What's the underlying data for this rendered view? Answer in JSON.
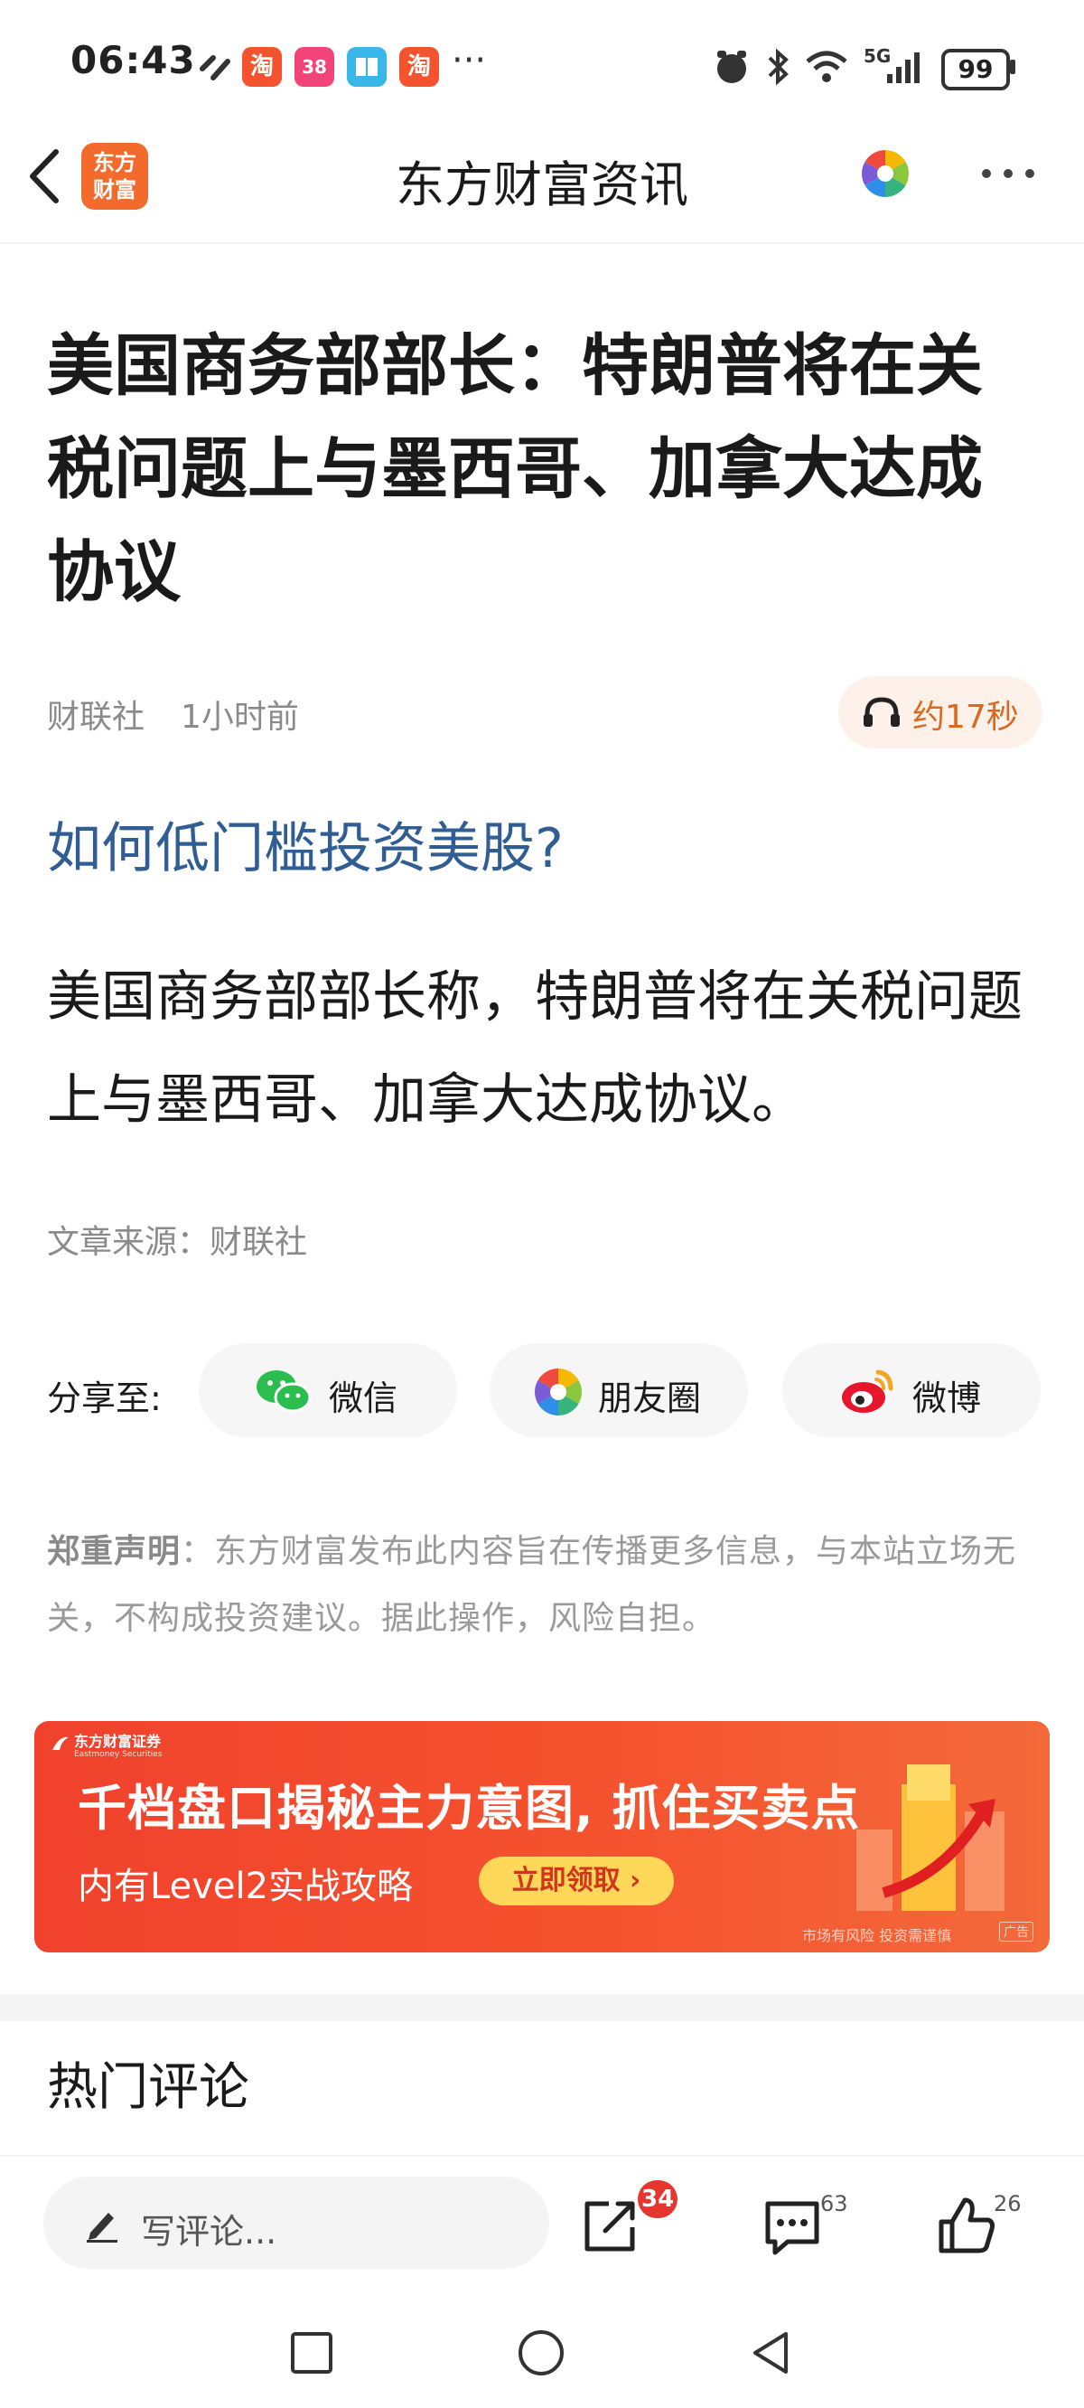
{
  "status_bar": {
    "time": "06:43",
    "app_icons": [
      {
        "name": "taobao-app-icon",
        "glyph": "淘",
        "color": "#f5532d"
      },
      {
        "name": "gift-app-icon",
        "glyph": "38",
        "color": "#f24479"
      },
      {
        "name": "book-app-icon",
        "glyph": "▮",
        "color": "#39b7e8"
      },
      {
        "name": "taobao-app-icon-2",
        "glyph": "淘",
        "color": "#f5532d"
      }
    ],
    "more": "···",
    "network": "5G",
    "battery": "99"
  },
  "header": {
    "title": "东方财富资讯",
    "logo_line1": "东方",
    "logo_line2": "财富"
  },
  "article": {
    "headline": "美国商务部部长：特朗普将在关税问题上与墨西哥、加拿大达成协议",
    "source": "财联社",
    "time_ago": "1小时前",
    "audio_label": "约17秒",
    "promo_link": "如何低门槛投资美股?",
    "body": "美国商务部部长称，特朗普将在关税问题上与墨西哥、加拿大达成协议。",
    "source_line": "文章来源：财联社"
  },
  "share": {
    "label": "分享至:",
    "wechat": "微信",
    "moments": "朋友圈",
    "weibo": "微博"
  },
  "disclaimer": {
    "title": "郑重声明",
    "text": "：东方财富发布此内容旨在传播更多信息，与本站立场无关，不构成投资建议。据此操作，风险自担。"
  },
  "banner": {
    "brand": "东方财富证券",
    "brand_en": "Eastmoney Securities",
    "headline": "千档盘口揭秘主力意图, 抓住买卖点",
    "subline": "内有Level2实战攻略",
    "cta": "立即领取 ›",
    "risk_note": "市场有风险 投资需谨慎",
    "ad_tag": "广告"
  },
  "comments": {
    "title": "热门评论"
  },
  "bottom_bar": {
    "placeholder": "写评论...",
    "share_badge": "34",
    "comment_count": "63",
    "like_count": "26"
  }
}
